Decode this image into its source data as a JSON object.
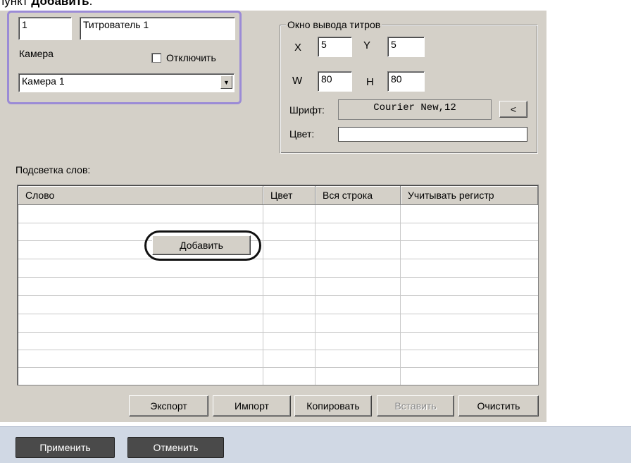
{
  "caption": {
    "prefix": "пункт ",
    "bold": "Добавить",
    "suffix": "."
  },
  "settings": {
    "id_value": "1",
    "name_value": "Титрователь 1",
    "camera_label": "Камера",
    "disable_label": "Отключить",
    "camera_selected": "Камера 1"
  },
  "title_window": {
    "group_title": "Окно вывода титров",
    "x_label": "X",
    "x_value": "5",
    "y_label": "Y",
    "y_value": "5",
    "w_label": "W",
    "w_value": "80",
    "h_label": "H",
    "h_value": "80",
    "font_label": "Шрифт:",
    "font_value": "Courier New,12",
    "font_button": "<",
    "color_label": "Цвет:"
  },
  "highlight": {
    "section_label": "Подсветка слов:",
    "columns": [
      "Слово",
      "Цвет",
      "Вся строка",
      "Учитывать регистр"
    ],
    "add_button": "Добавить"
  },
  "toolbar": {
    "export": "Экспорт",
    "import": "Импорт",
    "copy": "Копировать",
    "paste": "Вставить",
    "clear": "Очистить"
  },
  "footer": {
    "apply": "Применить",
    "cancel": "Отменить"
  }
}
